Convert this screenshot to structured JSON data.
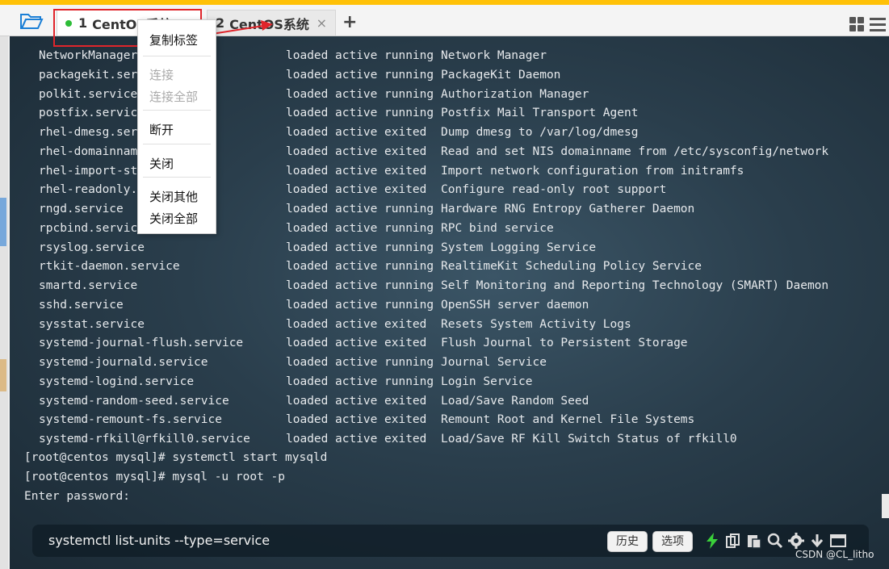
{
  "tabs": [
    {
      "number": "1",
      "title": "CentOS系统",
      "connected": true
    },
    {
      "number": "2",
      "title": "CentOS系统",
      "connected": false
    }
  ],
  "tab_close_glyph": "×",
  "new_tab_glyph": "+",
  "context_menu": {
    "items": [
      {
        "label": "复制标签",
        "enabled": true
      },
      {
        "label": "连接",
        "enabled": false
      },
      {
        "label": "连接全部",
        "enabled": false
      },
      {
        "label": "断开",
        "enabled": true
      },
      {
        "label": "关闭",
        "enabled": true
      },
      {
        "label": "关闭其他",
        "enabled": true
      },
      {
        "label": "关闭全部",
        "enabled": true
      }
    ]
  },
  "service_rows": [
    {
      "unit": "NetworkManager",
      "load": "loaded",
      "active": "active",
      "sub": "running",
      "description": "Network Manager"
    },
    {
      "unit": "packagekit.ser",
      "load": "loaded",
      "active": "active",
      "sub": "running",
      "description": "PackageKit Daemon"
    },
    {
      "unit": "polkit.service",
      "load": "loaded",
      "active": "active",
      "sub": "running",
      "description": "Authorization Manager"
    },
    {
      "unit": "postfix.service",
      "load": "loaded",
      "active": "active",
      "sub": "running",
      "description": "Postfix Mail Transport Agent"
    },
    {
      "unit": "rhel-dmesg.ser",
      "load": "loaded",
      "active": "active",
      "sub": "exited",
      "description": "Dump dmesg to /var/log/dmesg"
    },
    {
      "unit": "rhel-domainnam",
      "load": "loaded",
      "active": "active",
      "sub": "exited",
      "description": "Read and set NIS domainname from /etc/sysconfig/network"
    },
    {
      "unit": "rhel-import-st",
      "load": "loaded",
      "active": "active",
      "sub": "exited",
      "description": "Import network configuration from initramfs"
    },
    {
      "unit": "rhel-readonly.",
      "load": "loaded",
      "active": "active",
      "sub": "exited",
      "description": "Configure read-only root support"
    },
    {
      "unit": "rngd.service",
      "load": "loaded",
      "active": "active",
      "sub": "running",
      "description": "Hardware RNG Entropy Gatherer Daemon"
    },
    {
      "unit": "rpcbind.service",
      "load": "loaded",
      "active": "active",
      "sub": "running",
      "description": "RPC bind service"
    },
    {
      "unit": "rsyslog.service",
      "load": "loaded",
      "active": "active",
      "sub": "running",
      "description": "System Logging Service"
    },
    {
      "unit": "rtkit-daemon.service",
      "load": "loaded",
      "active": "active",
      "sub": "running",
      "description": "RealtimeKit Scheduling Policy Service"
    },
    {
      "unit": "smartd.service",
      "load": "loaded",
      "active": "active",
      "sub": "running",
      "description": "Self Monitoring and Reporting Technology (SMART) Daemon"
    },
    {
      "unit": "sshd.service",
      "load": "loaded",
      "active": "active",
      "sub": "running",
      "description": "OpenSSH server daemon"
    },
    {
      "unit": "sysstat.service",
      "load": "loaded",
      "active": "active",
      "sub": "exited",
      "description": "Resets System Activity Logs"
    },
    {
      "unit": "systemd-journal-flush.service",
      "load": "loaded",
      "active": "active",
      "sub": "exited",
      "description": "Flush Journal to Persistent Storage"
    },
    {
      "unit": "systemd-journald.service",
      "load": "loaded",
      "active": "active",
      "sub": "running",
      "description": "Journal Service"
    },
    {
      "unit": "systemd-logind.service",
      "load": "loaded",
      "active": "active",
      "sub": "running",
      "description": "Login Service"
    },
    {
      "unit": "systemd-random-seed.service",
      "load": "loaded",
      "active": "active",
      "sub": "exited",
      "description": "Load/Save Random Seed"
    },
    {
      "unit": "systemd-remount-fs.service",
      "load": "loaded",
      "active": "active",
      "sub": "exited",
      "description": "Remount Root and Kernel File Systems"
    },
    {
      "unit": "systemd-rfkill@rfkill0.service",
      "load": "loaded",
      "active": "active",
      "sub": "exited",
      "description": "Load/Save RF Kill Switch Status of rfkill0"
    }
  ],
  "prompt_lines": [
    "[root@centos mysql]# systemctl start mysqld",
    "[root@centos mysql]# mysql -u root -p",
    "Enter password:"
  ],
  "command_bar": {
    "command": "systemctl list-units --type=service",
    "history_button": "历史",
    "options_button": "选项"
  },
  "watermark": "CSDN @CL_litho",
  "colors": {
    "accent": "#ffc107",
    "annotation": "#e0252b",
    "connected_dot": "#2dbd37"
  }
}
